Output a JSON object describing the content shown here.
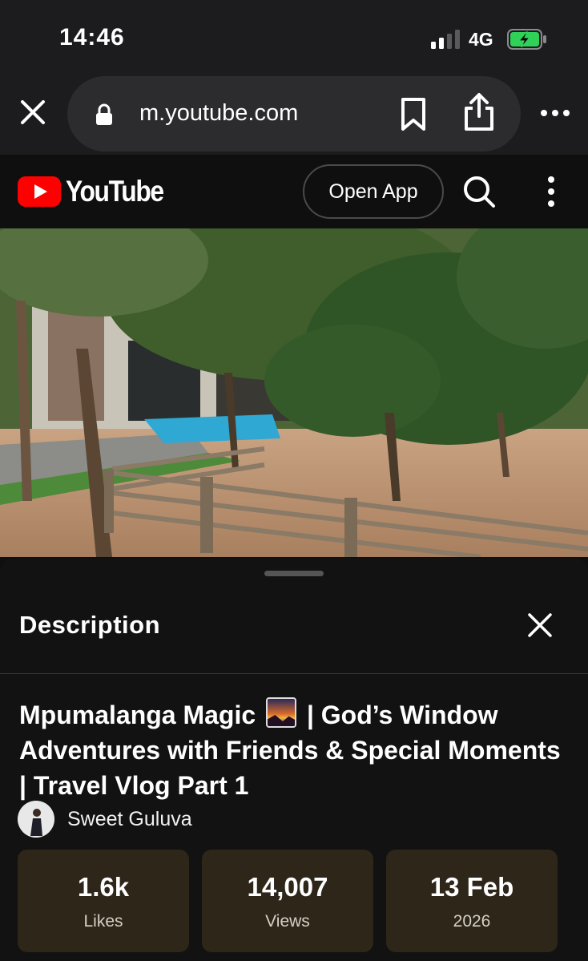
{
  "status_bar": {
    "time": "14:46",
    "network": "4G",
    "signal_bars_active": 2,
    "signal_bars_total": 4,
    "battery_charging": true,
    "battery_color": "#30d158"
  },
  "browser": {
    "url": "m.youtube.com",
    "close_icon": "close-icon",
    "lock_icon": "lock-icon",
    "bookmark_icon": "bookmark-icon",
    "share_icon": "share-icon",
    "more_icon": "more-horizontal-icon"
  },
  "youtube_header": {
    "logo_text": "YouTube",
    "brand_color": "#ff0000",
    "open_app_label": "Open App",
    "search_icon": "search-icon",
    "menu_icon": "more-vertical-icon"
  },
  "description_panel": {
    "title": "Description",
    "close_icon": "close-icon",
    "video_title_part1": "Mpumalanga Magic",
    "video_title_emoji": "sunrise-over-mountains-emoji",
    "video_title_part2": "| God’s Window Adventures with Friends & Special Moments | Travel Vlog Part 1",
    "channel_name": "Sweet Guluva",
    "stats": [
      {
        "value": "1.6k",
        "label": "Likes"
      },
      {
        "value": "14,007",
        "label": "Views"
      },
      {
        "value": "13 Feb",
        "label": "2026"
      }
    ]
  }
}
